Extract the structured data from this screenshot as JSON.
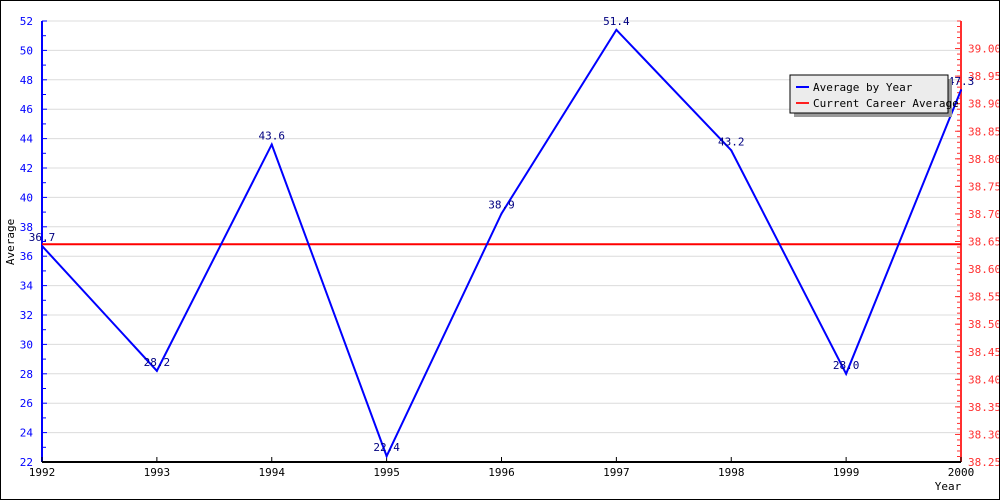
{
  "chart_data": {
    "type": "line",
    "title": "",
    "xlabel": "Year",
    "ylabel": "Average",
    "x": [
      1992,
      1993,
      1994,
      1995,
      1996,
      1997,
      1998,
      1999,
      2000
    ],
    "x_ticks": [
      "1992",
      "1993",
      "1994",
      "1995",
      "1996",
      "1997",
      "1998",
      "1999",
      "2000"
    ],
    "ylim": [
      22,
      52
    ],
    "y_ticks": [
      "22",
      "24",
      "26",
      "28",
      "30",
      "32",
      "34",
      "36",
      "38",
      "40",
      "42",
      "44",
      "46",
      "48",
      "50",
      "52"
    ],
    "y2lim": [
      38.25,
      39.05
    ],
    "y2_ticks": [
      "38.25",
      "38.30",
      "38.35",
      "38.40",
      "38.45",
      "38.50",
      "38.55",
      "38.60",
      "38.65",
      "38.70",
      "38.75",
      "38.80",
      "38.85",
      "38.90",
      "38.95",
      "39.00"
    ],
    "grid": true,
    "legend_position": "top-right",
    "series": [
      {
        "name": "Average by Year",
        "axis": "left",
        "color": "#0000ff",
        "values": [
          36.7,
          28.2,
          43.6,
          22.4,
          38.9,
          51.4,
          43.2,
          28.0,
          47.3
        ],
        "labels": [
          "36.7",
          "28.2",
          "43.6",
          "22.4",
          "38.9",
          "51.4",
          "43.2",
          "28.0",
          "47.3"
        ]
      },
      {
        "name": "Current Career Average",
        "axis": "right",
        "color": "#ff0000",
        "value": 38.645
      }
    ]
  }
}
